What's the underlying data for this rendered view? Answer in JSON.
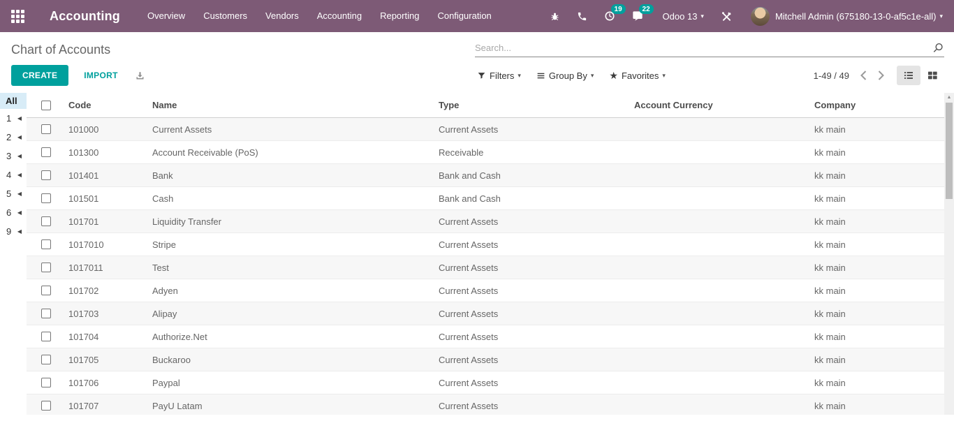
{
  "colors": {
    "navbar_bg": "#7d5a76",
    "accent_teal": "#00a09d",
    "badge_bg": "#00a09d",
    "sidebar_active_bg": "#d8ecf7",
    "row_stripe": "#f7f7f7"
  },
  "icons": {
    "apps": "grid-3x3",
    "bug": "bug",
    "phone": "phone-receiver",
    "activity": "clock",
    "messages": "chat-bubble",
    "tools": "crossed-tools",
    "caret": "▾",
    "favorites_star": "★",
    "sidebar_arrow": "◀",
    "scroll_up": "▲",
    "search": "magnifier",
    "filters": "funnel",
    "group_by": "horizontal-bars",
    "download": "download-tray",
    "prev": "chevron-left",
    "next": "chevron-right",
    "list_view": "list-bullets",
    "kanban_view": "grid-2x2"
  },
  "navbar": {
    "app_title": "Accounting",
    "menu_items": [
      "Overview",
      "Customers",
      "Vendors",
      "Accounting",
      "Reporting",
      "Configuration"
    ],
    "activity_count": "19",
    "message_count": "22",
    "version_label": "Odoo 13",
    "user_name": "Mitchell Admin (675180-13-0-af5c1e-all)"
  },
  "control_panel": {
    "title": "Chart of Accounts",
    "create_label": "CREATE",
    "import_label": "IMPORT",
    "search_placeholder": "Search...",
    "filters_label": "Filters",
    "group_by_label": "Group By",
    "favorites_label": "Favorites",
    "pager": "1-49 / 49"
  },
  "sidebar": {
    "all_label": "All",
    "groups": [
      "1",
      "2",
      "3",
      "4",
      "5",
      "6",
      "9"
    ]
  },
  "table": {
    "headers": [
      "Code",
      "Name",
      "Type",
      "Account Currency",
      "Company"
    ],
    "rows": [
      {
        "code": "101000",
        "name": "Current Assets",
        "type": "Current Assets",
        "currency": "",
        "company": "kk main"
      },
      {
        "code": "101300",
        "name": "Account Receivable (PoS)",
        "type": "Receivable",
        "currency": "",
        "company": "kk main"
      },
      {
        "code": "101401",
        "name": "Bank",
        "type": "Bank and Cash",
        "currency": "",
        "company": "kk main"
      },
      {
        "code": "101501",
        "name": "Cash",
        "type": "Bank and Cash",
        "currency": "",
        "company": "kk main"
      },
      {
        "code": "101701",
        "name": "Liquidity Transfer",
        "type": "Current Assets",
        "currency": "",
        "company": "kk main"
      },
      {
        "code": "1017010",
        "name": "Stripe",
        "type": "Current Assets",
        "currency": "",
        "company": "kk main"
      },
      {
        "code": "1017011",
        "name": "Test",
        "type": "Current Assets",
        "currency": "",
        "company": "kk main"
      },
      {
        "code": "101702",
        "name": "Adyen",
        "type": "Current Assets",
        "currency": "",
        "company": "kk main"
      },
      {
        "code": "101703",
        "name": "Alipay",
        "type": "Current Assets",
        "currency": "",
        "company": "kk main"
      },
      {
        "code": "101704",
        "name": "Authorize.Net",
        "type": "Current Assets",
        "currency": "",
        "company": "kk main"
      },
      {
        "code": "101705",
        "name": "Buckaroo",
        "type": "Current Assets",
        "currency": "",
        "company": "kk main"
      },
      {
        "code": "101706",
        "name": "Paypal",
        "type": "Current Assets",
        "currency": "",
        "company": "kk main"
      },
      {
        "code": "101707",
        "name": "PayU Latam",
        "type": "Current Assets",
        "currency": "",
        "company": "kk main"
      }
    ]
  }
}
